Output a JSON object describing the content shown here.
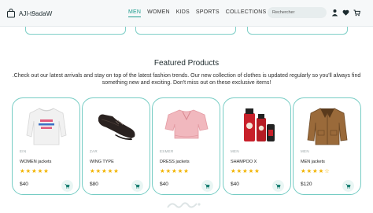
{
  "brand": {
    "name": "AJl-t9adaW",
    "accent_color": "#1f9c8e"
  },
  "nav": {
    "links": [
      {
        "label": "MEN",
        "active": true
      },
      {
        "label": "WOMEN",
        "active": false
      },
      {
        "label": "KIDS",
        "active": false
      },
      {
        "label": "SPORTS",
        "active": false
      },
      {
        "label": "COLLECTIONS",
        "active": false
      }
    ],
    "search_placeholder": "Rechercher",
    "icons": [
      "user-icon",
      "heart-icon",
      "cart-icon"
    ]
  },
  "featured": {
    "title": "Featured Products",
    "description": ".Check out our latest arrivals and stay on top of the latest fashion trends. Our new collection of clothes is updated regularly so you'll always find something new and exciting. Don't miss out on these exclusive items!"
  },
  "products": [
    {
      "brand": "EIN",
      "name": "WOMEN jackets",
      "stars": "★★★★★",
      "rating": 5,
      "price": "$40",
      "image": "white-sweatshirt"
    },
    {
      "brand": "ZAR",
      "name": "WING TYPE",
      "stars": "★★★★★",
      "rating": 5,
      "price": "$80",
      "image": "leather-shoe"
    },
    {
      "brand": "ESMER",
      "name": "DRESS jackets",
      "stars": "★★★★★",
      "rating": 5,
      "price": "$40",
      "image": "pink-blouse"
    },
    {
      "brand": "MEN",
      "name": "SHAMPOO X",
      "stars": "★★★★★",
      "rating": 5,
      "price": "$40",
      "image": "shampoo-set"
    },
    {
      "brand": "MEN",
      "name": "MEN jackets",
      "stars": "★★★★☆",
      "rating": 4.5,
      "price": "$120",
      "image": "brown-jacket"
    }
  ]
}
